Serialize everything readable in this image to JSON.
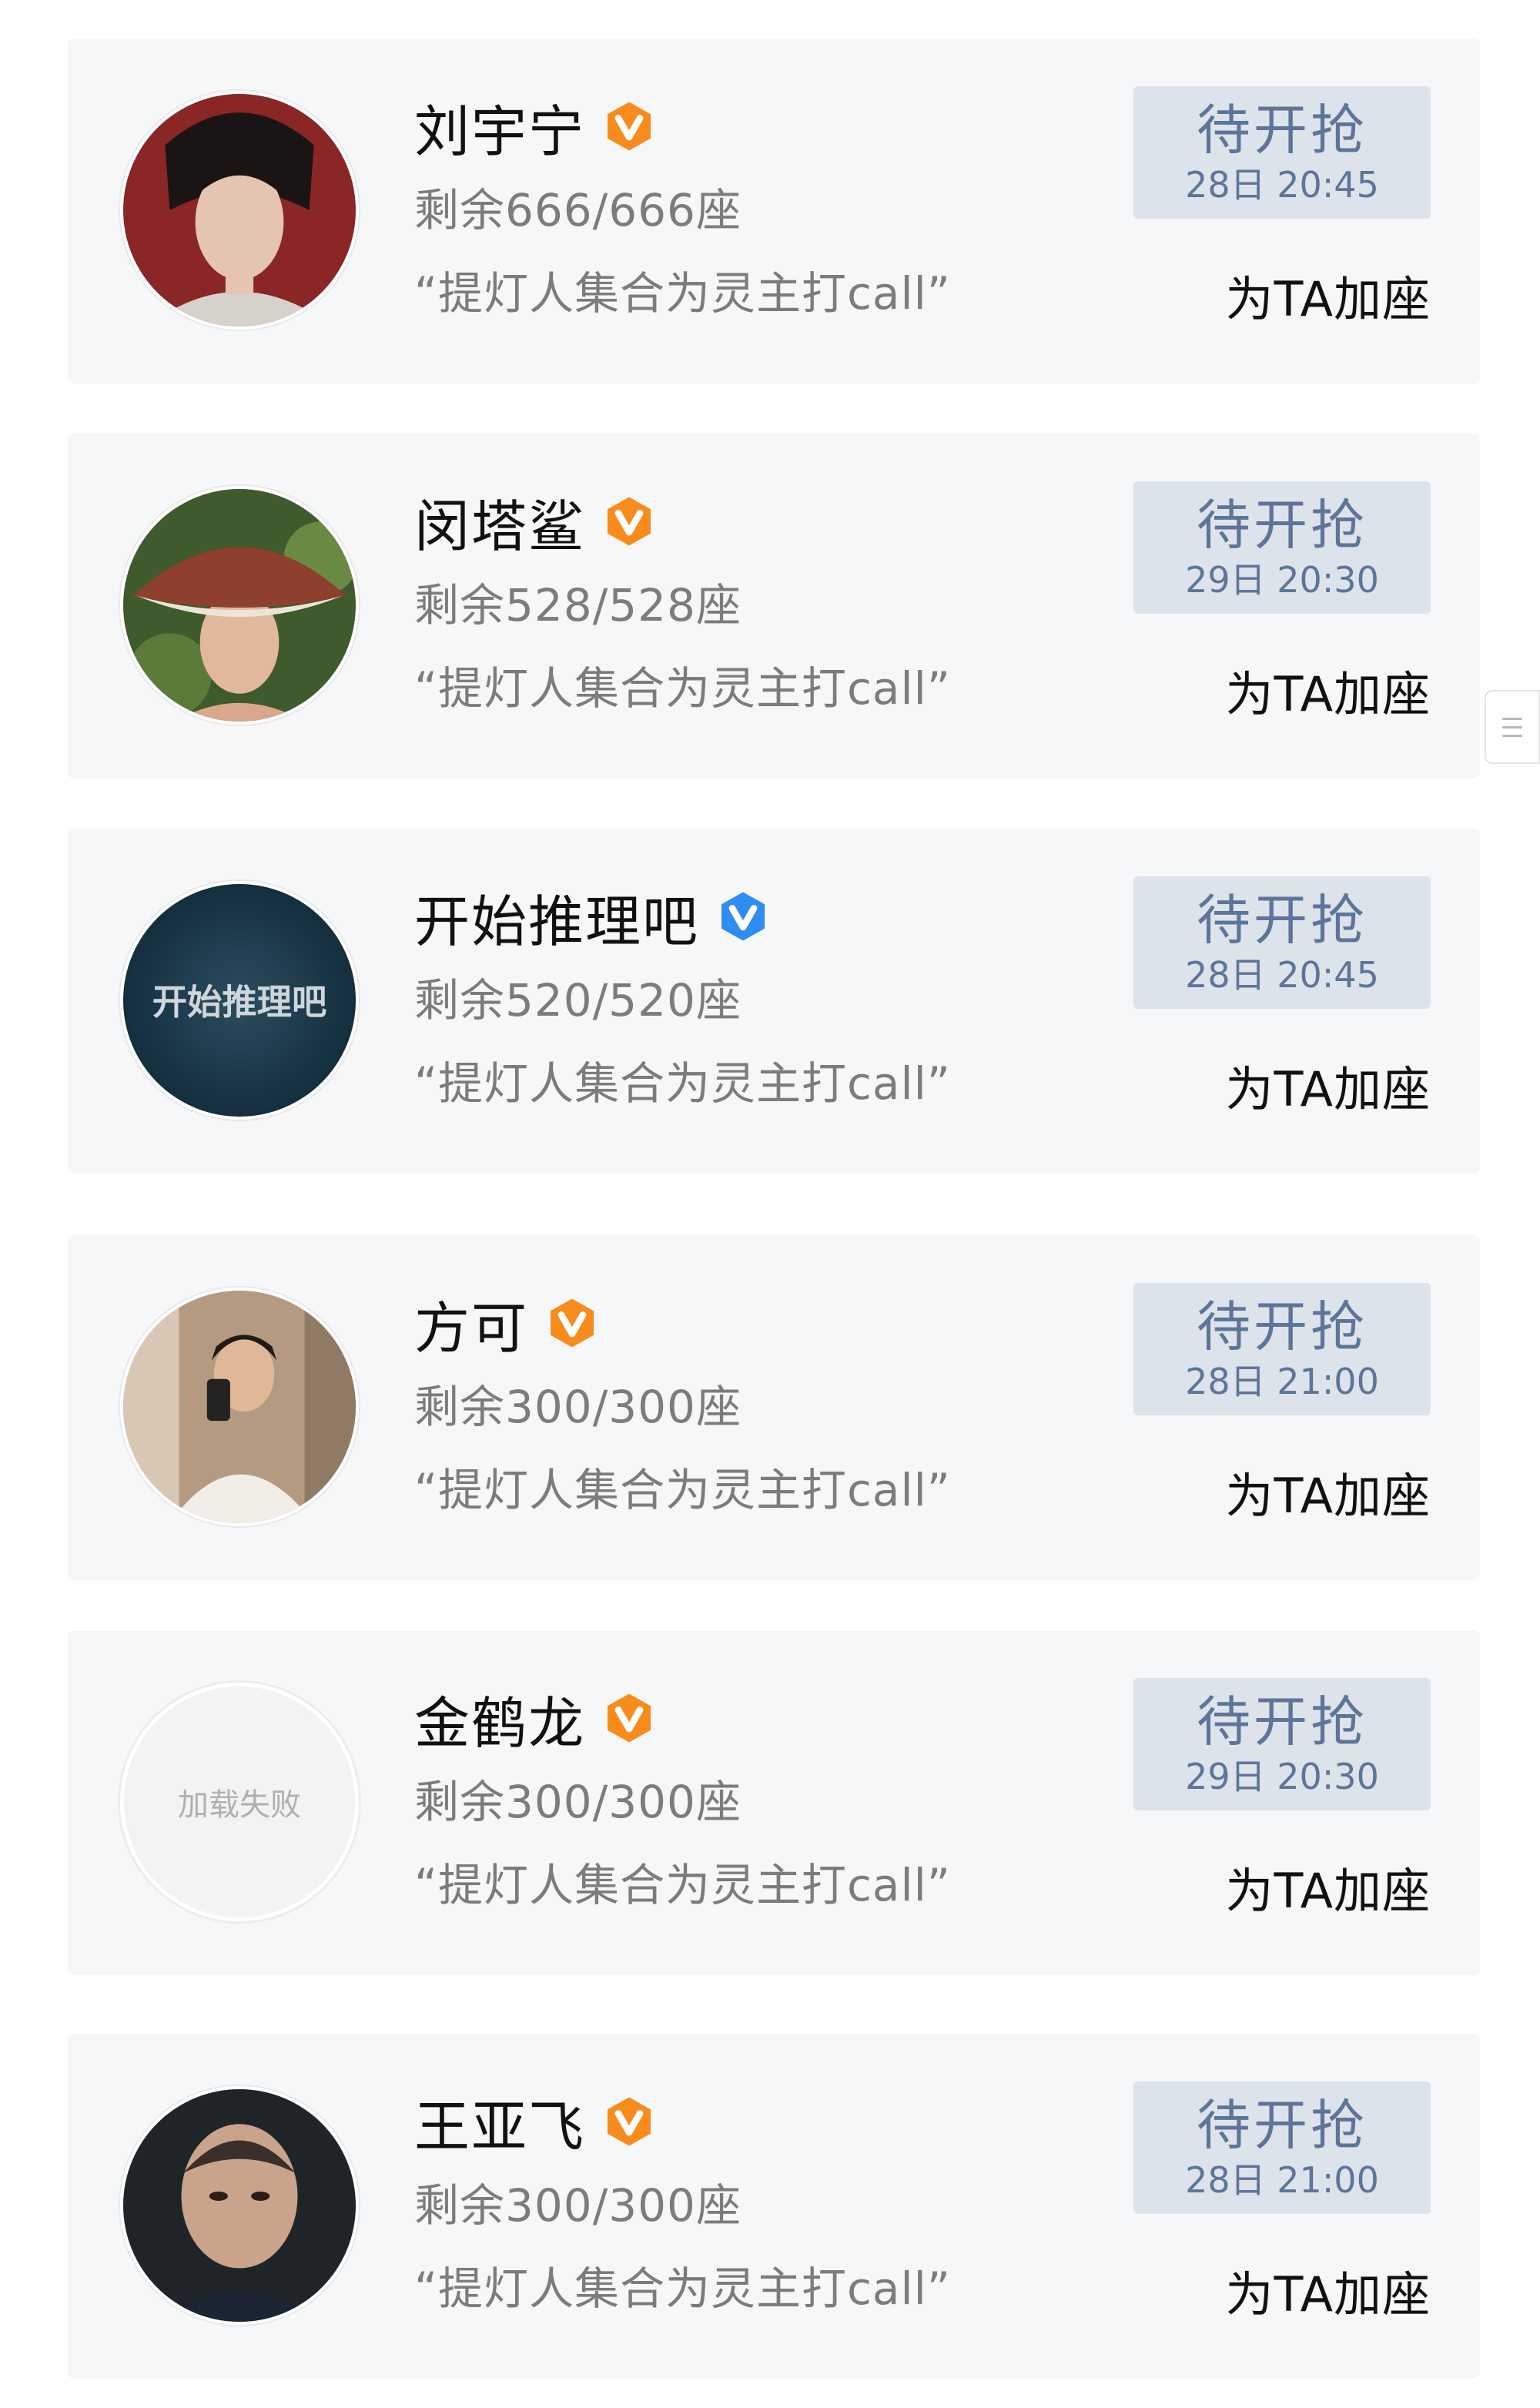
{
  "items": [
    {
      "name": "刘宇宁",
      "verified_color": "#f78c1c",
      "remain": "剩余666/666座",
      "slogan": "“提灯人集合为灵主打call”",
      "button_label": "待开抢",
      "button_time": "28日 20:45",
      "add_seat": "为TA加座",
      "avatar": "portrait-avatar"
    },
    {
      "name": "闵塔鲨",
      "verified_color": "#f78c1c",
      "remain": "剩余528/528座",
      "slogan": "“提灯人集合为灵主打call”",
      "button_label": "待开抢",
      "button_time": "29日 20:30",
      "add_seat": "为TA加座",
      "avatar": "portrait-avatar"
    },
    {
      "name": "开始推理吧",
      "verified_color": "#2f8cf0",
      "remain": "剩余520/520座",
      "slogan": "“提灯人集合为灵主打call”",
      "button_label": "待开抢",
      "button_time": "28日 20:45",
      "add_seat": "为TA加座",
      "avatar": "logo-avatar",
      "avatar_text": "开始推理吧"
    },
    {
      "name": "方可",
      "verified_color": "#f78c1c",
      "remain": "剩余300/300座",
      "slogan": "“提灯人集合为灵主打call”",
      "button_label": "待开抢",
      "button_time": "28日 21:00",
      "add_seat": "为TA加座",
      "avatar": "portrait-avatar"
    },
    {
      "name": "金鹤龙",
      "verified_color": "#f78c1c",
      "remain": "剩余300/300座",
      "slogan": "“提灯人集合为灵主打call”",
      "button_label": "待开抢",
      "button_time": "29日 20:30",
      "add_seat": "为TA加座",
      "avatar": "failed-avatar",
      "avatar_text": "加载失败"
    },
    {
      "name": "王亚飞",
      "verified_color": "#f78c1c",
      "remain": "剩余300/300座",
      "slogan": "“提灯人集合为灵主打call”",
      "button_label": "待开抢",
      "button_time": "28日 21:00",
      "add_seat": "为TA加座",
      "avatar": "portrait-avatar"
    }
  ]
}
